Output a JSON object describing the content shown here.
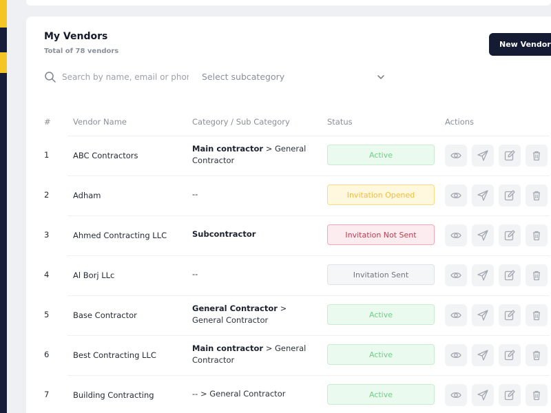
{
  "page": {
    "title": "My Vendors",
    "subtitle": "Total of 78 vendors",
    "new_button": "New Vendor"
  },
  "filters": {
    "search_placeholder": "Search by name, email or phone",
    "subcategory_placeholder": "Select subcategory"
  },
  "table": {
    "columns": [
      "#",
      "Vendor Name",
      "Category / Sub Category",
      "Status",
      "Actions"
    ],
    "rows": [
      {
        "num": "1",
        "name": "ABC Contractors",
        "category": "Main contractor",
        "sep": " > ",
        "subcategory": "General Contractor",
        "status": "Active",
        "status_kind": "active"
      },
      {
        "num": "2",
        "name": "Adham",
        "category": "",
        "sep": "",
        "subcategory": "--",
        "status": "Invitation Opened",
        "status_kind": "opened"
      },
      {
        "num": "3",
        "name": "Ahmed Contracting LLC",
        "category": "Subcontractor",
        "sep": "",
        "subcategory": "",
        "status": "Invitation Not Sent",
        "status_kind": "notsent"
      },
      {
        "num": "4",
        "name": "Al Borj LLc",
        "category": "",
        "sep": "",
        "subcategory": "--",
        "status": "Invitation Sent",
        "status_kind": "sent"
      },
      {
        "num": "5",
        "name": "Base Contractor",
        "category": "General Contractor",
        "sep": " > ",
        "subcategory": "General Contractor",
        "status": "Active",
        "status_kind": "active"
      },
      {
        "num": "6",
        "name": "Best Contracting LLC",
        "category": "Main contractor",
        "sep": " > ",
        "subcategory": "General Contractor",
        "status": "Active",
        "status_kind": "active"
      },
      {
        "num": "7",
        "name": "Building Contracting",
        "category": "",
        "sep": "",
        "subcategory": "-- > General Contractor",
        "status": "Active",
        "status_kind": "active"
      }
    ]
  },
  "icons": {
    "search": "search-icon",
    "chevron": "chevron-down-icon",
    "view": "eye-icon",
    "send": "send-icon",
    "edit": "edit-icon",
    "delete": "trash-icon"
  },
  "colors": {
    "sidebar": "#151d3b",
    "accent": "#f3c623",
    "primary_button": "#141b33",
    "active": "#6fce86",
    "opened": "#f0bc3a",
    "not_sent": "#c0384e",
    "sent": "#6f7480"
  }
}
